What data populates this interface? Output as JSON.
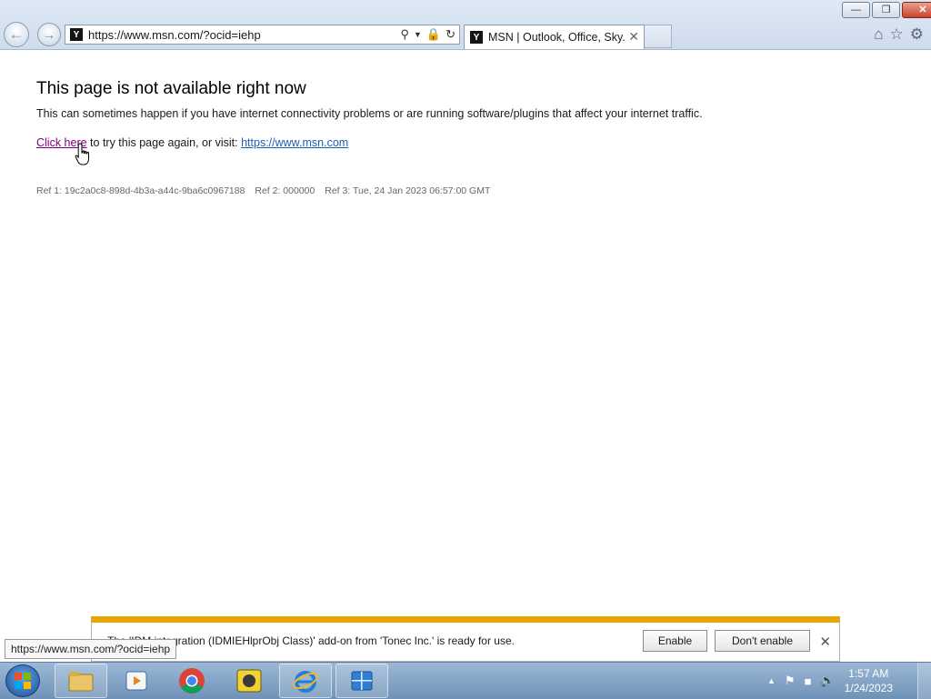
{
  "browser": {
    "address_url": "https://www.msn.com/?ocid=iehp",
    "tab_title": "MSN | Outlook, Office, Sky...",
    "favicon_letter": "Y"
  },
  "page": {
    "title": "This page is not available right now",
    "description": "This can sometimes happen if you have internet connectivity problems or are running software/plugins that affect your internet traffic.",
    "retry_link": "Click here",
    "retry_suffix": " to try this page again, or visit: ",
    "msn_link": "https://www.msn.com",
    "ref1": "Ref 1: 19c2a0c8-898d-4b3a-a44c-9ba6c0967188",
    "ref2": "Ref 2: 000000",
    "ref3": "Ref 3: Tue, 24 Jan 2023 06:57:00 GMT"
  },
  "notification": {
    "message": "The 'IDM integration (IDMIEHlprObj Class)' add-on from 'Tonec Inc.' is ready for use.",
    "enable_label": "Enable",
    "dont_enable_label": "Don't enable"
  },
  "status_tooltip": "https://www.msn.com/?ocid=iehp",
  "taskbar": {
    "time": "1:57 AM",
    "date": "1/24/2023",
    "apps": [
      "explorer-icon",
      "media-player-icon",
      "chrome-icon",
      "app-icon",
      "internet-explorer-icon",
      "app-window-icon"
    ]
  },
  "colors": {
    "notification_accent": "#e7a700",
    "visited_link": "#800080",
    "link": "#1a5fb4"
  }
}
